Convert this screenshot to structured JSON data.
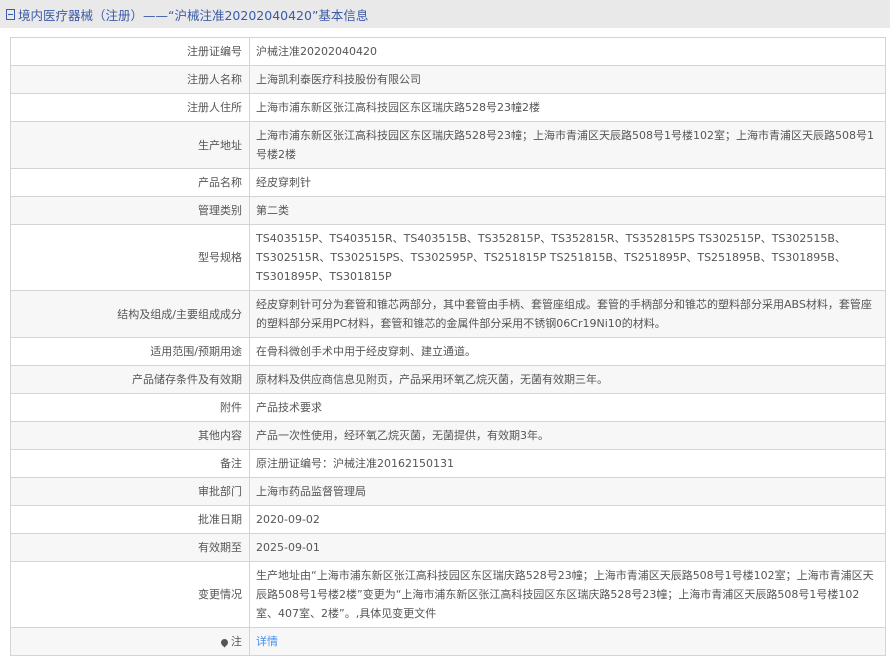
{
  "header": {
    "title": "境内医疗器械（注册）——“沪械注准20202040420”基本信息"
  },
  "rows": [
    {
      "label": "注册证编号",
      "value": "沪械注准20202040420"
    },
    {
      "label": "注册人名称",
      "value": "上海凯利泰医疗科技股份有限公司"
    },
    {
      "label": "注册人住所",
      "value": "上海市浦东新区张江高科技园区东区瑞庆路528号23幢2楼"
    },
    {
      "label": "生产地址",
      "value": "上海市浦东新区张江高科技园区东区瑞庆路528号23幢；上海市青浦区天辰路508号1号楼102室；上海市青浦区天辰路508号1号楼2楼"
    },
    {
      "label": "产品名称",
      "value": "经皮穿刺针"
    },
    {
      "label": "管理类别",
      "value": "第二类"
    },
    {
      "label": "型号规格",
      "value": "TS403515P、TS403515R、TS403515B、TS352815P、TS352815R、TS352815PS TS302515P、TS302515B、TS302515R、TS302515PS、TS302595P、TS251815P TS251815B、TS251895P、TS251895B、TS301895B、TS301895P、TS301815P"
    },
    {
      "label": "结构及组成/主要组成成分",
      "value": "经皮穿刺针可分为套管和锥芯两部分，其中套管由手柄、套管座组成。套管的手柄部分和锥芯的塑料部分采用ABS材料，套管座的塑料部分采用PC材料，套管和锥芯的金属件部分采用不锈钢06Cr19Ni10的材料。"
    },
    {
      "label": "适用范围/预期用途",
      "value": "在骨科微创手术中用于经皮穿刺、建立通道。"
    },
    {
      "label": "产品储存条件及有效期",
      "value": "原材料及供应商信息见附页，产品采用环氧乙烷灭菌，无菌有效期三年。"
    },
    {
      "label": "附件",
      "value": "产品技术要求"
    },
    {
      "label": "其他内容",
      "value": "产品一次性使用，经环氧乙烷灭菌，无菌提供，有效期3年。"
    },
    {
      "label": "备注",
      "value": "原注册证编号：沪械注准20162150131"
    },
    {
      "label": "审批部门",
      "value": "上海市药品监督管理局"
    },
    {
      "label": "批准日期",
      "value": "2020-09-02"
    },
    {
      "label": "有效期至",
      "value": "2025-09-01"
    },
    {
      "label": "变更情况",
      "value": "生产地址由“上海市浦东新区张江高科技园区东区瑞庆路528号23幢；上海市青浦区天辰路508号1号楼102室；上海市青浦区天辰路508号1号楼2楼”变更为“上海市浦东新区张江高科技园区东区瑞庆路528号23幢；上海市青浦区天辰路508号1号楼102室、407室、2楼”。,具体见变更文件"
    }
  ],
  "note": {
    "label": "注",
    "link": "详情",
    "icon": "location-pin-icon"
  }
}
